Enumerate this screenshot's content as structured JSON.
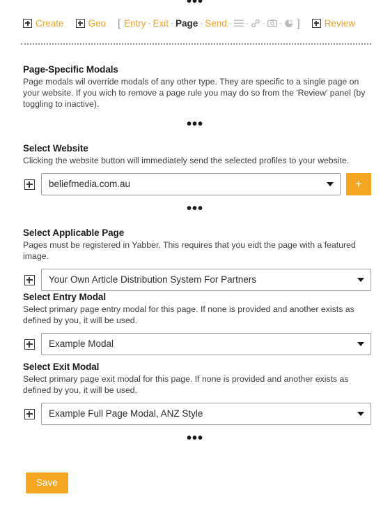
{
  "separators": {
    "dots": "•••"
  },
  "navbar": {
    "create_label": "Create",
    "geo_label": "Geo",
    "bracket_open": "[",
    "bracket_close": "]",
    "sep": "·",
    "entry_label": "Entry",
    "exit_label": "Exit",
    "page_label": "Page",
    "send_label": "Send",
    "review_label": "Review",
    "icons": [
      "list-icon",
      "link-icon",
      "camera-icon",
      "pie-chart-icon"
    ]
  },
  "intro": {
    "title": "Page-Specific Modals",
    "description": "Page modals wil override modals of any other type. They are specific to a single page on your website. If you wich to remove a page rule you may do so from the 'Review' panel (by toggling to inactive)."
  },
  "website": {
    "title": "Select Website",
    "description": "Clicking the website button will immediately send the selected profiles to your website.",
    "selected": "beliefmedia.com.au",
    "add_label": "+"
  },
  "applicable_page": {
    "title": "Select Applicable Page",
    "description": "Pages must be registered in Yabber. This requires that you eidt the page with a featured image.",
    "selected": "Your Own Article Distribution System For Partners"
  },
  "entry_modal": {
    "title": "Select Entry Modal",
    "description": "Select primary page entry modal for this page. If none is provided and another exists as defined by you, it will be used.",
    "selected": "Example Modal"
  },
  "exit_modal": {
    "title": "Select Exit Modal",
    "description": "Select primary page exit modal for this page. If none is provided and another exists as defined by you, it will be used.",
    "selected": "Example Full Page Modal, ANZ Style"
  },
  "footer": {
    "save_label": "Save"
  },
  "colors": {
    "accent_orange": "#f5a623",
    "link_orange": "#f0a32a",
    "text_dark": "#2b2b2b",
    "icon_gray": "#b9b9b9"
  }
}
